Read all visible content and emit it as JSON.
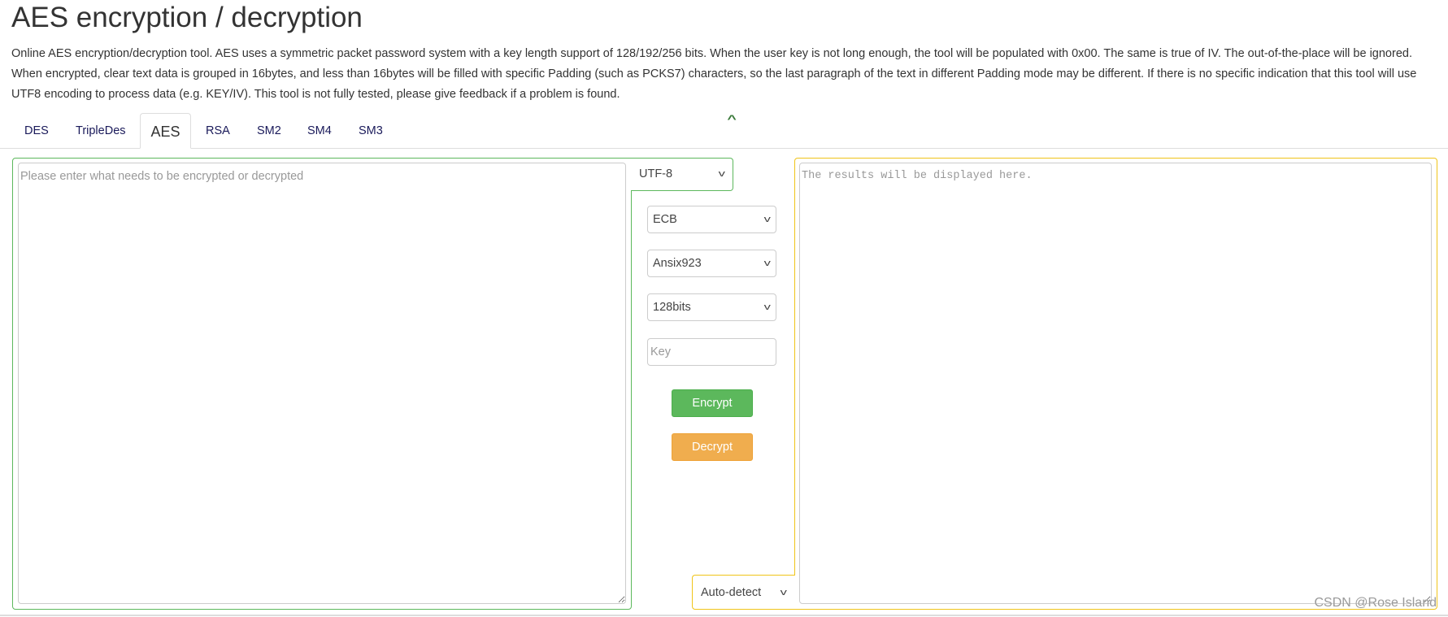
{
  "page": {
    "title": "AES encryption / decryption",
    "description": "Online AES encryption/decryption tool. AES uses a symmetric packet password system with a key length support of 128/192/256 bits. When the user key is not long enough, the tool will be populated with 0x00. The same is true of IV. The out-of-the-place will be ignored. When encrypted, clear text data is grouped in 16bytes, and less than 16bytes will be filled with specific Padding (such as PCKS7) characters, so the last paragraph of the text in different Padding mode may be different. If there is no specific indication that this tool will use UTF8 encoding to process data (e.g. KEY/IV). This tool is not fully tested, please give feedback if a problem is found."
  },
  "tabs": [
    {
      "label": "DES"
    },
    {
      "label": "TripleDes"
    },
    {
      "label": "AES",
      "active": true
    },
    {
      "label": "RSA"
    },
    {
      "label": "SM2"
    },
    {
      "label": "SM4"
    },
    {
      "label": "SM3"
    }
  ],
  "collapse_icon": "chevron-up-icon",
  "input": {
    "placeholder": "Please enter what needs to be encrypted or decrypted",
    "value": "",
    "encoding": "UTF-8"
  },
  "options": {
    "mode": "ECB",
    "padding": "Ansix923",
    "key_size": "128bits",
    "key_placeholder": "Key",
    "key_value": ""
  },
  "buttons": {
    "encrypt": "Encrypt",
    "decrypt": "Decrypt"
  },
  "output": {
    "placeholder": "The results will be displayed here.",
    "value": "",
    "encoding": "Auto-detect"
  },
  "watermark": "CSDN @Rose Island",
  "colors": {
    "input_border": "#5cb85c",
    "output_border": "#f0c419",
    "encrypt": "#5cb85c",
    "decrypt": "#f0ad4e"
  }
}
